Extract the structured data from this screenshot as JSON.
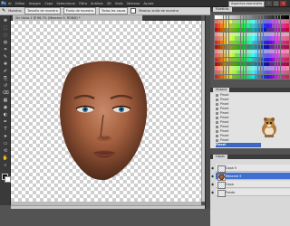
{
  "app": {
    "logo": "Ps",
    "menu": [
      "Ar",
      "Editar",
      "Imagen",
      "Capa",
      "Seleccionar",
      "Filtro",
      "Análisis",
      "3D",
      "Vista",
      "Ventana",
      "Ayuda"
    ],
    "workspace_label": "Aspectos esenciales"
  },
  "options_bar": {
    "items": [
      "Muestra:",
      "Tamaño de muestra",
      "Punto de muestra",
      "Todas las capas",
      "Mostrar anillo de muestra"
    ]
  },
  "document": {
    "tab_title": "Sin título-1 @ 66,7% (Mascara 5, RGB/8) *"
  },
  "tools": [
    "move-tool",
    "marquee-tool",
    "lasso-tool",
    "quick-select-tool",
    "crop-tool",
    "eyedropper-tool",
    "healing-tool",
    "brush-tool",
    "clone-stamp-tool",
    "history-brush-tool",
    "eraser-tool",
    "gradient-tool",
    "blur-tool",
    "dodge-tool",
    "pen-tool",
    "type-tool",
    "path-select-tool",
    "shape-tool",
    "3d-rotate-tool",
    "hand-tool",
    "zoom-tool"
  ],
  "panels": {
    "swatches_tab": "Muestras",
    "history_tab": "Historia",
    "history_items": [
      "Pincel",
      "Pincel",
      "Pincel",
      "Pincel",
      "Pincel",
      "Pincel",
      "Pincel",
      "Pincel",
      "Pincel",
      "Pincel",
      "Pincel"
    ],
    "history_selected": "Pincel",
    "layers_tab": "Capas",
    "layers": [
      {
        "name": "Capa 5",
        "selected": false
      },
      {
        "name": "Mascara 5",
        "selected": true
      },
      {
        "name": "Capa",
        "selected": false
      },
      {
        "name": "Fondo",
        "selected": false
      }
    ]
  },
  "colors": {
    "selection": "#3c68c4",
    "canvas_check": "#cfcfcf",
    "chrome_dark": "#535353"
  }
}
